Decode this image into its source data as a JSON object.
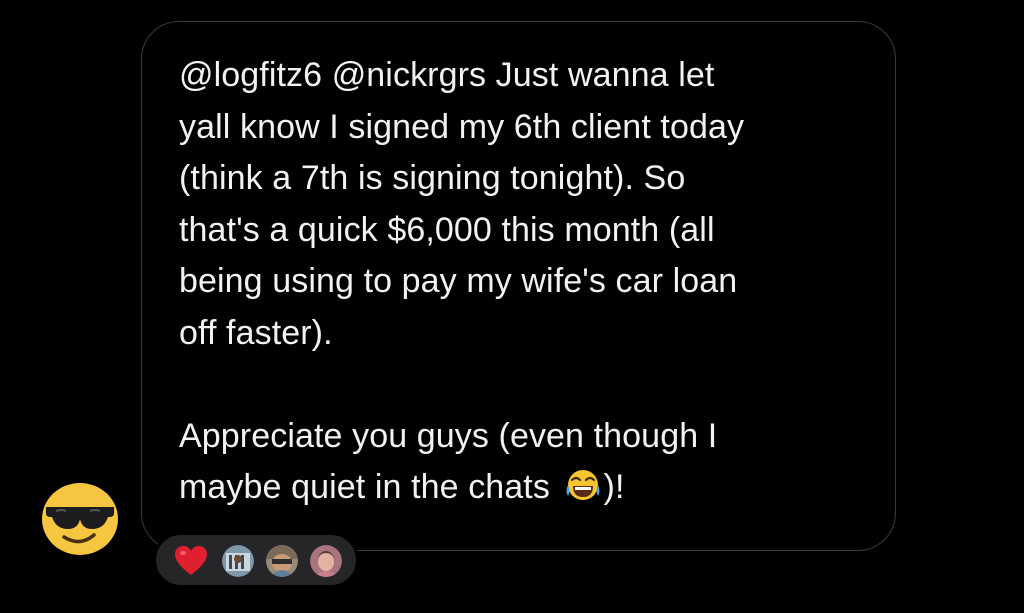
{
  "previous_message": {
    "visible": true
  },
  "message": {
    "lines_paragraph1": [
      "@logfitz6 @nickrgrs Just wanna let",
      "yall know I signed my 6th client today",
      "(think a 7th is signing tonight). So",
      "that's a quick $6,000 this month (all",
      "being using to pay my wife's car loan",
      "off faster)."
    ],
    "lines_paragraph2": [
      "Appreciate you guys (even though I",
      "maybe quiet in the chats",
      ")!"
    ],
    "inline_emoji": "face-with-tears-of-joy-icon"
  },
  "sender_avatar": {
    "icon": "smiling-face-with-sunglasses-icon"
  },
  "reactions": {
    "emoji": "red-heart-icon",
    "reactor_avatars": [
      "reactor-avatar-1",
      "reactor-avatar-2",
      "reactor-avatar-3"
    ]
  },
  "colors": {
    "background": "#000000",
    "bubble_border": "#3a3a3c",
    "text": "#f2f2f2",
    "reaction_pill": "#262628",
    "heart": "#e0202e"
  }
}
